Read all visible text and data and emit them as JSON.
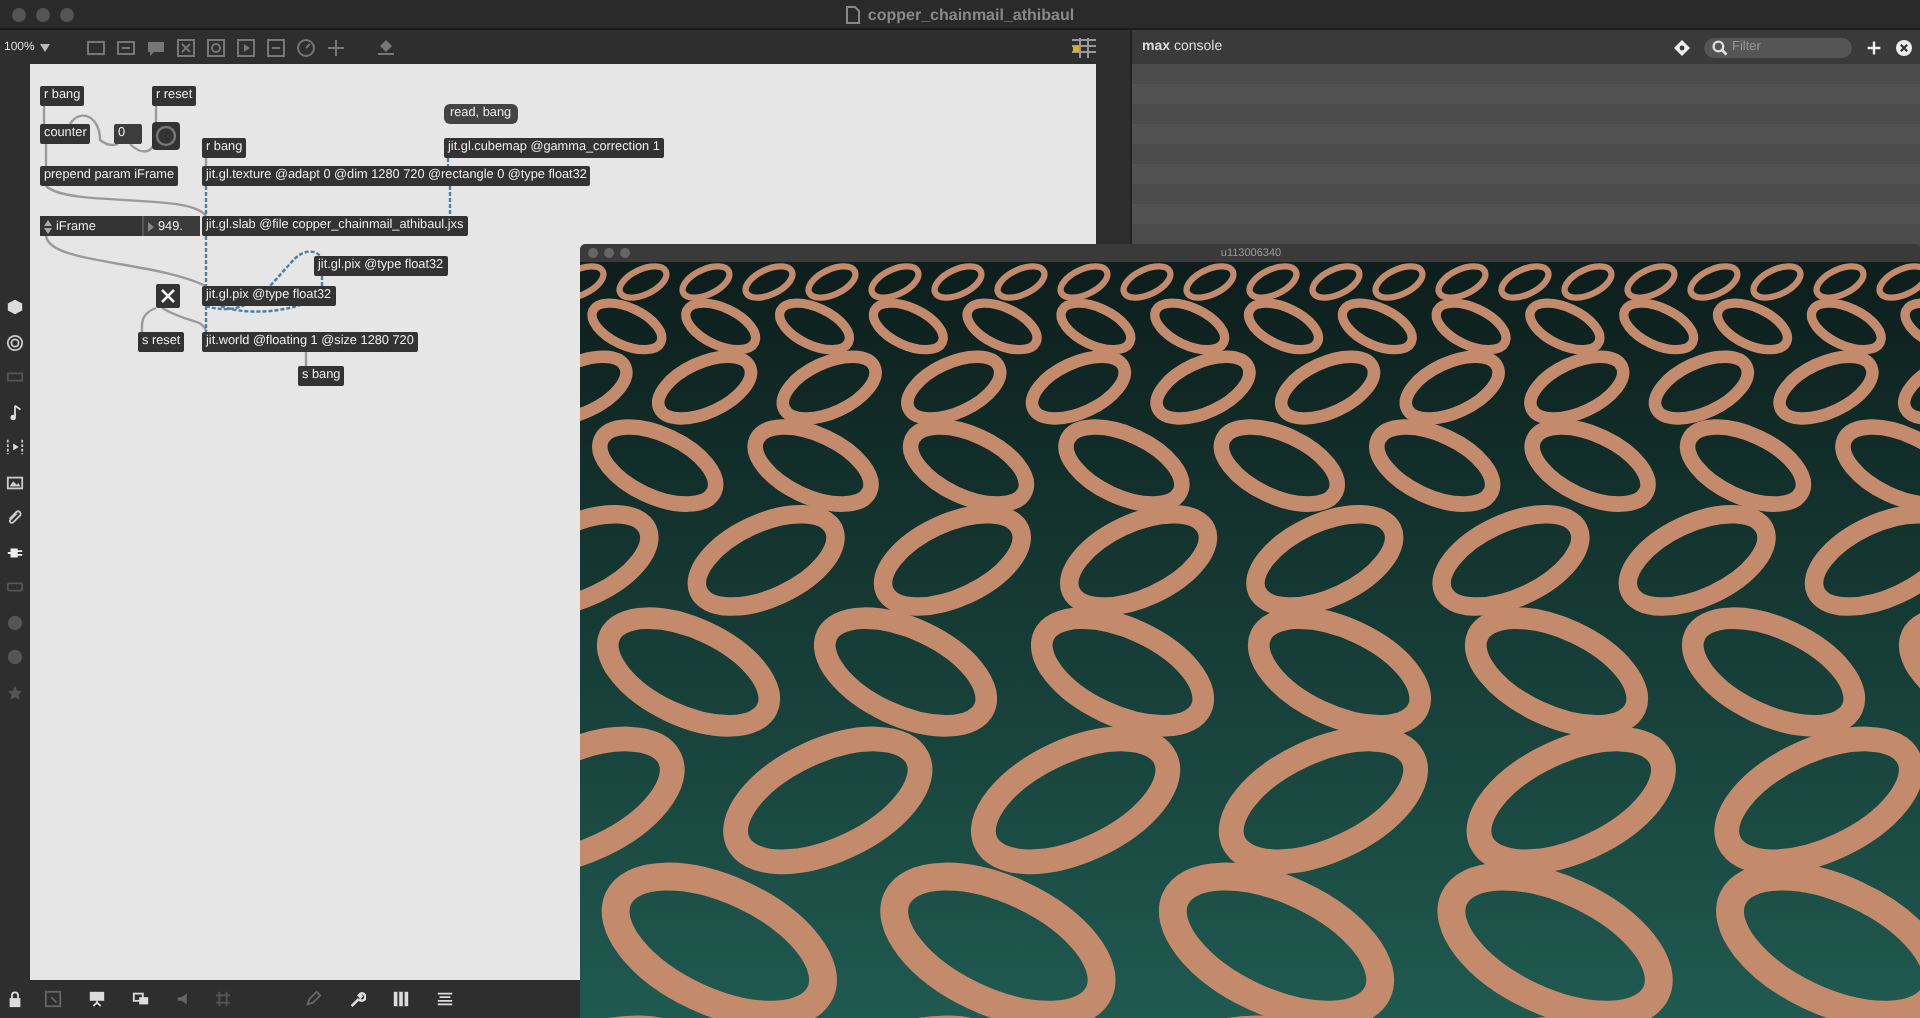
{
  "window": {
    "title": "copper_chainmail_athibaul"
  },
  "toolbar": {
    "zoom": "100%"
  },
  "patch": [
    {
      "kind": "object",
      "text": "r bang"
    },
    {
      "kind": "object",
      "text": "r reset"
    },
    {
      "kind": "object",
      "text": "counter"
    },
    {
      "kind": "number",
      "text": "0"
    },
    {
      "kind": "bang"
    },
    {
      "kind": "message",
      "text": "read, bang"
    },
    {
      "kind": "object",
      "text": "r bang"
    },
    {
      "kind": "object",
      "text": "jit.gl.cubemap @gamma_correction 1"
    },
    {
      "kind": "object",
      "text": "prepend param iFrame"
    },
    {
      "kind": "object",
      "text": "jit.gl.texture @adapt 0 @dim 1280 720 @rectangle 0 @type float32"
    },
    {
      "kind": "attrui",
      "text": "iFrame",
      "value": "949."
    },
    {
      "kind": "object",
      "text": "jit.gl.slab @file copper_chainmail_athibaul.jxs"
    },
    {
      "kind": "object",
      "text": "jit.gl.pix @type float32"
    },
    {
      "kind": "toggle",
      "checked": true
    },
    {
      "kind": "object",
      "text": "jit.gl.pix @type float32"
    },
    {
      "kind": "object",
      "text": "s reset"
    },
    {
      "kind": "object",
      "text": "jit.world @floating 1 @size 1280 720"
    },
    {
      "kind": "object",
      "text": "s bang"
    }
  ],
  "console": {
    "title": "**max** console",
    "filter_placeholder": "Filter"
  },
  "render_window": {
    "title": "u113006340"
  }
}
